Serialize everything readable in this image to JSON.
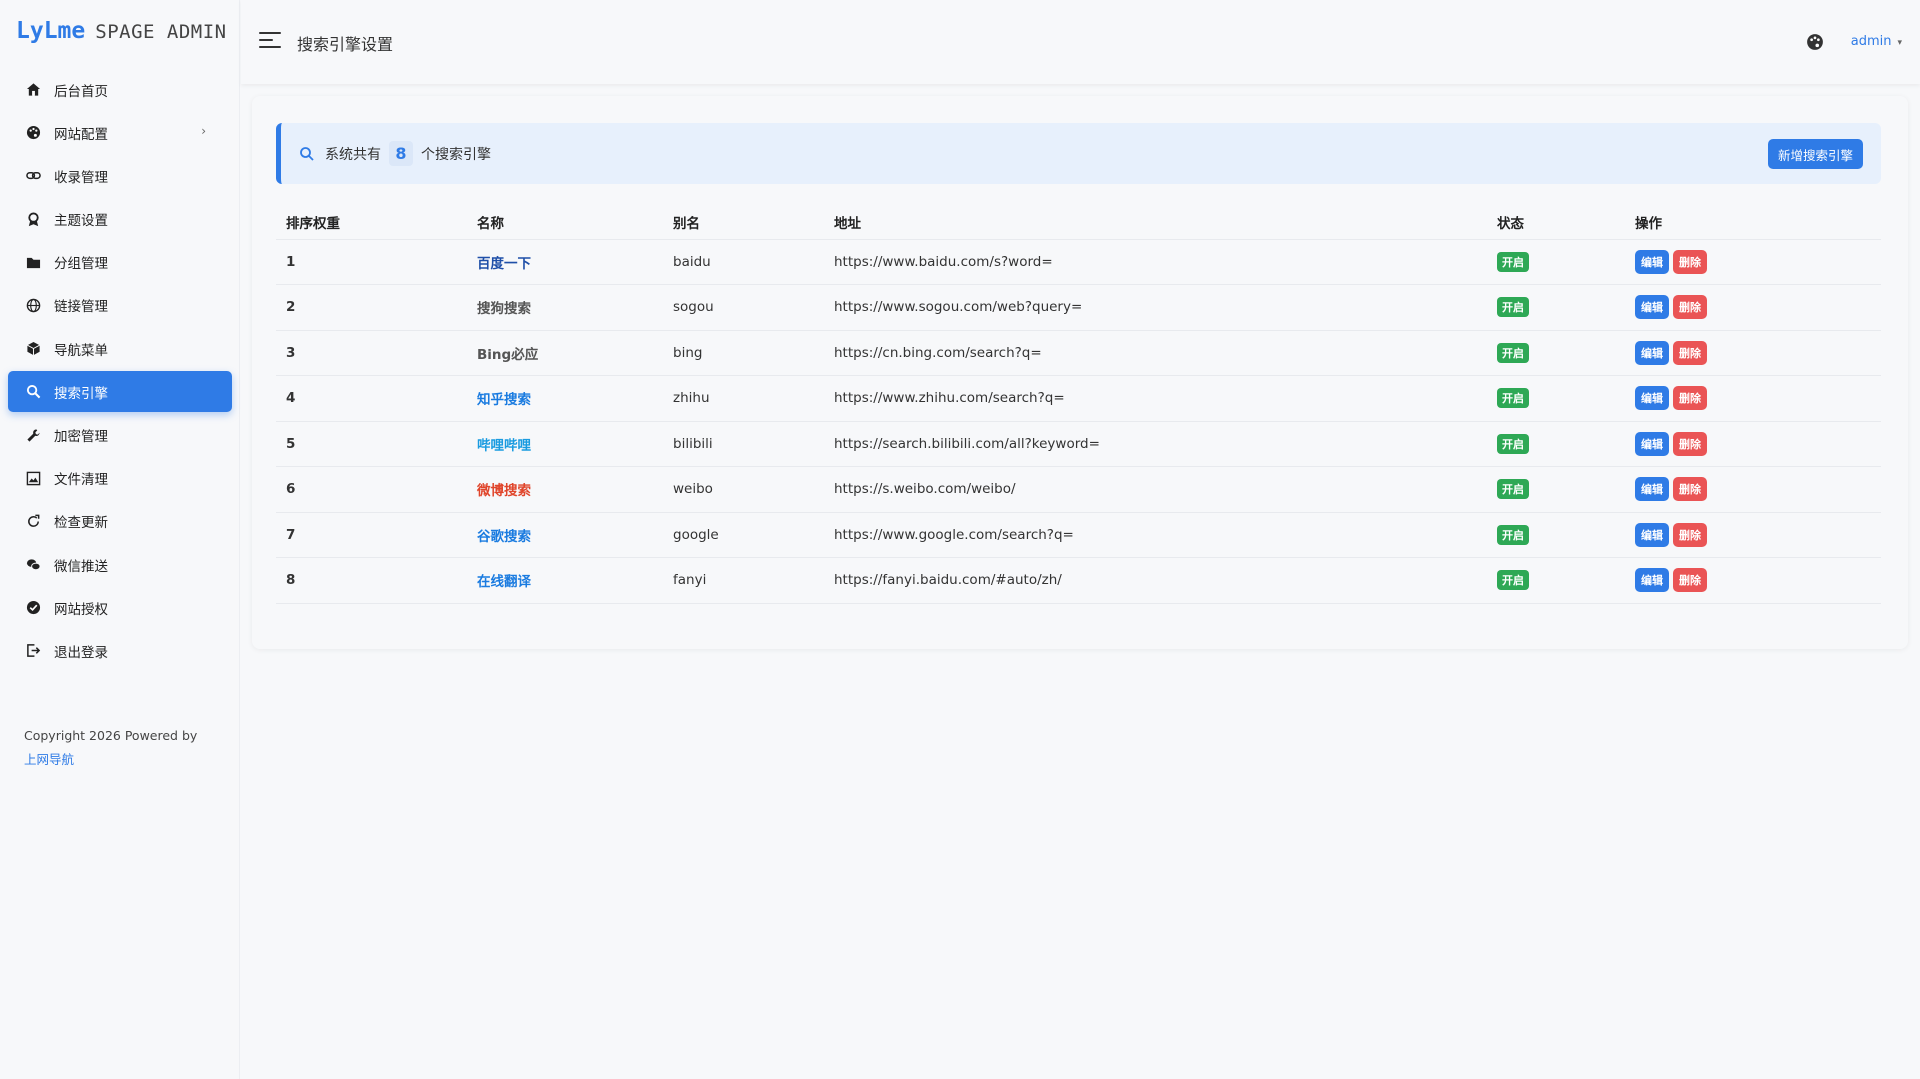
{
  "brand": {
    "logo": "LyLme",
    "sub": "SPAGE ADMIN"
  },
  "sidebar": {
    "items": [
      {
        "label": "后台首页",
        "icon": "home-icon"
      },
      {
        "label": "网站配置",
        "icon": "palette-icon",
        "has_arrow": true
      },
      {
        "label": "收录管理",
        "icon": "link-icon"
      },
      {
        "label": "主题设置",
        "icon": "award-icon"
      },
      {
        "label": "分组管理",
        "icon": "folder-icon"
      },
      {
        "label": "链接管理",
        "icon": "globe-icon"
      },
      {
        "label": "导航菜单",
        "icon": "box-icon"
      },
      {
        "label": "搜索引擎",
        "icon": "search-icon",
        "active": true
      },
      {
        "label": "加密管理",
        "icon": "wrench-icon"
      },
      {
        "label": "文件清理",
        "icon": "image-icon"
      },
      {
        "label": "检查更新",
        "icon": "refresh-icon"
      },
      {
        "label": "微信推送",
        "icon": "wechat-icon"
      },
      {
        "label": "网站授权",
        "icon": "check-circle-icon"
      },
      {
        "label": "退出登录",
        "icon": "logout-icon"
      }
    ],
    "arrow": "›"
  },
  "copyright": {
    "text": "Copyright 2026 Powered by",
    "link": "上网导航"
  },
  "header": {
    "title": "搜索引擎设置",
    "user": "admin",
    "caret": "▾"
  },
  "notice": {
    "prefix": "系统共有",
    "count": "8",
    "suffix": "个搜索引擎",
    "add_button": "新增搜索引擎"
  },
  "table": {
    "headers": [
      "排序权重",
      "名称",
      "别名",
      "地址",
      "状态",
      "操作"
    ],
    "edit_label": "编辑",
    "delete_label": "删除",
    "rows": [
      {
        "order": "1",
        "name": "百度一下",
        "name_color": "#1f4fa8",
        "alias": "baidu",
        "url": "https://www.baidu.com/s?word=",
        "status": "开启"
      },
      {
        "order": "2",
        "name": "搜狗搜索",
        "name_color": "#555555",
        "alias": "sogou",
        "url": "https://www.sogou.com/web?query=",
        "status": "开启"
      },
      {
        "order": "3",
        "name": "Bing必应",
        "name_color": "#555555",
        "alias": "bing",
        "url": "https://cn.bing.com/search?q=",
        "status": "开启"
      },
      {
        "order": "4",
        "name": "知乎搜索",
        "name_color": "#1a7be0",
        "alias": "zhihu",
        "url": "https://www.zhihu.com/search?q=",
        "status": "开启"
      },
      {
        "order": "5",
        "name": "哔哩哔哩",
        "name_color": "#1a9be0",
        "alias": "bilibili",
        "url": "https://search.bilibili.com/all?keyword=",
        "status": "开启"
      },
      {
        "order": "6",
        "name": "微博搜索",
        "name_color": "#e0452b",
        "alias": "weibo",
        "url": "https://s.weibo.com/weibo/",
        "status": "开启"
      },
      {
        "order": "7",
        "name": "谷歌搜索",
        "name_color": "#1a7be0",
        "alias": "google",
        "url": "https://www.google.com/search?q=",
        "status": "开启"
      },
      {
        "order": "8",
        "name": "在线翻译",
        "name_color": "#1a7be0",
        "alias": "fanyi",
        "url": "https://fanyi.baidu.com/#auto/zh/",
        "status": "开启"
      }
    ]
  },
  "colors": {
    "accent": "#2f7be6",
    "success": "#2ea855",
    "danger": "#ea5455"
  }
}
